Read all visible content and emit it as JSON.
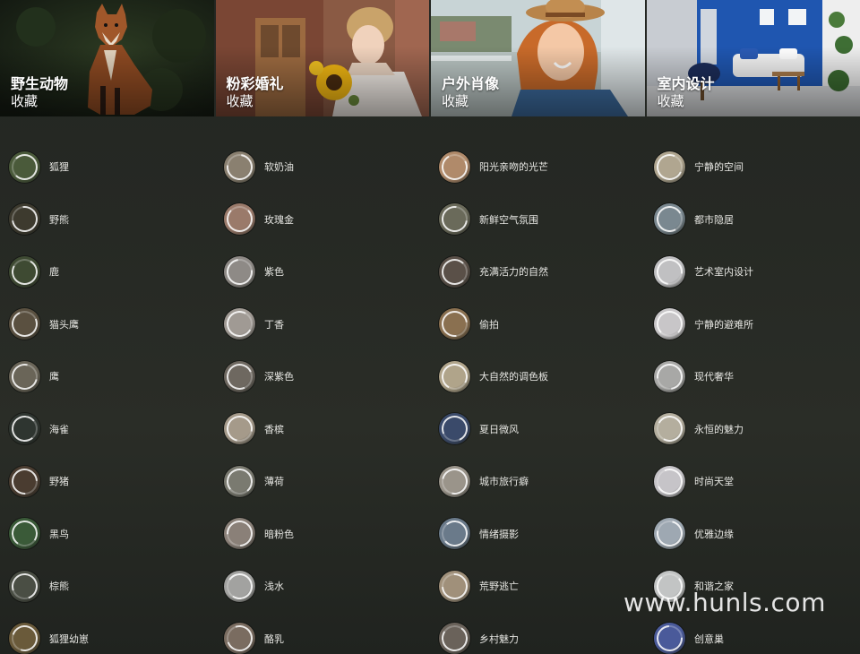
{
  "collections": [
    {
      "title": "野生动物",
      "subtitle": "收藏",
      "icon": "fox-photo"
    },
    {
      "title": "粉彩婚礼",
      "subtitle": "收藏",
      "icon": "bride-sunflower-photo"
    },
    {
      "title": "户外肖像",
      "subtitle": "收藏",
      "icon": "girl-hat-photo"
    },
    {
      "title": "室内设计",
      "subtitle": "收藏",
      "icon": "living-room-photo"
    }
  ],
  "presets": [
    [
      "狐狸",
      "野熊",
      "鹿",
      "猫头鹰",
      "鹰",
      "海雀",
      "野猪",
      "黑鸟",
      "棕熊",
      "狐狸幼崽"
    ],
    [
      "软奶油",
      "玫瑰金",
      "紫色",
      "丁香",
      "深紫色",
      "香槟",
      "薄荷",
      "暗粉色",
      "浅水",
      "酪乳"
    ],
    [
      "阳光亲吻的光芒",
      "新鲜空气氛围",
      "充满活力的自然",
      "偷拍",
      "大自然的调色板",
      "夏日微风",
      "城市旅行癖",
      "情绪摄影",
      "荒野逃亡",
      "乡村魅力"
    ],
    [
      "宁静的空间",
      "都市隐居",
      "艺术室内设计",
      "宁静的避难所",
      "现代奢华",
      "永恒的魅力",
      "时尚天堂",
      "优雅边缘",
      "和谐之家",
      "创意巢"
    ]
  ],
  "thumb_colors": [
    [
      "#4a5a3a",
      "#3d3a2e",
      "#3e4a32",
      "#5a5040",
      "#6a6558",
      "#2e3530",
      "#4a3c30",
      "#3a5a38",
      "#4a4e44",
      "#6a5a3a"
    ],
    [
      "#8a8070",
      "#9a7a6a",
      "#8e8a86",
      "#a09a94",
      "#6e6860",
      "#a59a8a",
      "#7a7a70",
      "#8a8078",
      "#a2a2a0",
      "#7a6c60"
    ],
    [
      "#b08a6a",
      "#6a6a5a",
      "#5a5048",
      "#8a7050",
      "#b0a48a",
      "#3a4a6a",
      "#9a948a",
      "#6a7a8a",
      "#a0907a",
      "#6a625a"
    ],
    [
      "#b0a690",
      "#7a8890",
      "#c0c0c2",
      "#c8c6c8",
      "#a8a8a6",
      "#b4ae9e",
      "#c6c4c8",
      "#9ea8b2",
      "#c2c4c4",
      "#4a5a9a"
    ]
  ],
  "watermark": "www.hunls.com"
}
